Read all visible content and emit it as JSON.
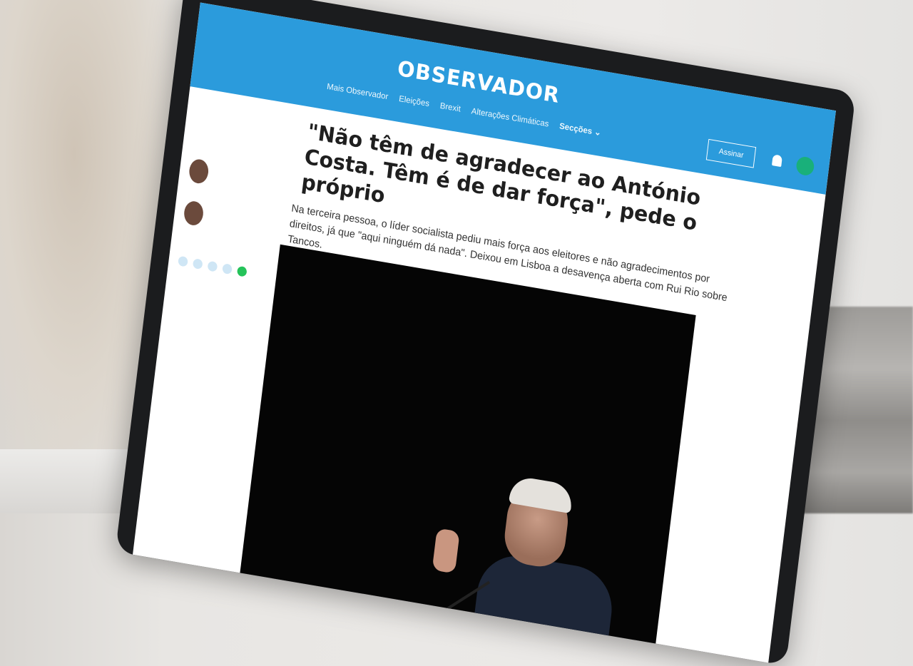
{
  "site": {
    "logo": "OBSERVADOR",
    "nav": [
      "Mais Observador",
      "Eleições",
      "Brexit",
      "Alterações Climáticas"
    ],
    "sections_label": "Secções ⌄",
    "subscribe_label": "Assinar"
  },
  "sidebar": {
    "authors": [
      {
        "name": ""
      },
      {
        "name": ""
      }
    ]
  },
  "article": {
    "headline": "\"Não têm de agradecer ao António Costa. Têm é de dar força\", pede o próprio",
    "lead": "Na terceira pessoa, o líder socialista pediu mais força aos eleitores e não agradecimentos por direitos, já que \"aqui ninguém dá nada\". Deixou em Lisboa a desavença aberta com Rui Rio sobre Tancos."
  },
  "colors": {
    "brand": "#2b9bdc",
    "avatar": "#19b07a",
    "whatsapp": "#25c35a"
  }
}
